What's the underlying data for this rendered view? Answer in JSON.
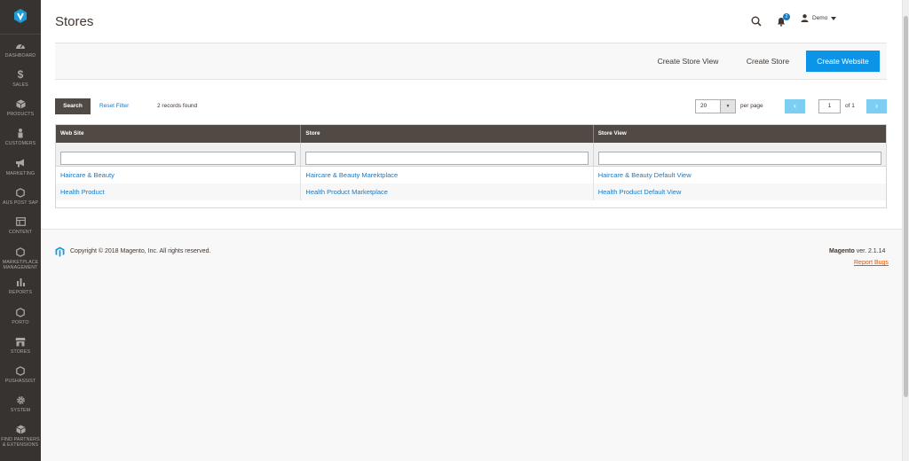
{
  "sidebar": {
    "items": [
      {
        "label": "DASHBOARD",
        "icon": "dashboard-icon"
      },
      {
        "label": "SALES",
        "icon": "dollar-icon"
      },
      {
        "label": "PRODUCTS",
        "icon": "cube-icon"
      },
      {
        "label": "CUSTOMERS",
        "icon": "person-icon"
      },
      {
        "label": "MARKETING",
        "icon": "megaphone-icon"
      },
      {
        "label": "AUS POST SAP",
        "icon": "hexagon-icon"
      },
      {
        "label": "CONTENT",
        "icon": "layout-icon"
      },
      {
        "label": "MARKETPLACE\nMANAGEMENT",
        "icon": "hexagon-icon"
      },
      {
        "label": "REPORTS",
        "icon": "bar-chart-icon"
      },
      {
        "label": "PORTO",
        "icon": "hexagon-icon"
      },
      {
        "label": "STORES",
        "icon": "store-icon"
      },
      {
        "label": "PUSHASSIST",
        "icon": "hexagon-icon"
      },
      {
        "label": "SYSTEM",
        "icon": "gear-icon"
      },
      {
        "label": "FIND PARTNERS\n& EXTENSIONS",
        "icon": "cube-icon"
      }
    ]
  },
  "header": {
    "title": "Stores",
    "notification_count": "2",
    "user_name": "Demo"
  },
  "actions": {
    "create_store_view": "Create Store View",
    "create_store": "Create Store",
    "create_website": "Create Website"
  },
  "grid_controls": {
    "search": "Search",
    "reset_filter": "Reset Filter",
    "records_found": "2 records found",
    "per_page_value": "20",
    "per_page_label": "per page",
    "current_page": "1",
    "of_pages": "of 1"
  },
  "table": {
    "columns": [
      "Web Site",
      "Store",
      "Store View"
    ],
    "rows": [
      [
        "Haircare & Beauty",
        "Haircare & Beauty Marektplace",
        "Haircare & Beauty Default View"
      ],
      [
        "Health Product",
        "Health Product Marketplace",
        "Health Product Default View"
      ]
    ]
  },
  "footer": {
    "copyright": "Copyright © 2018 Magento, Inc. All rights reserved.",
    "brand": "Magento",
    "version": " ver. 2.1.14",
    "report_bugs": "Report Bugs"
  },
  "colors": {
    "sidebar": "#373330",
    "primary": "#0c95e8",
    "table_header": "#514943",
    "link": "#1979c3",
    "report_bugs": "#eb5202"
  }
}
